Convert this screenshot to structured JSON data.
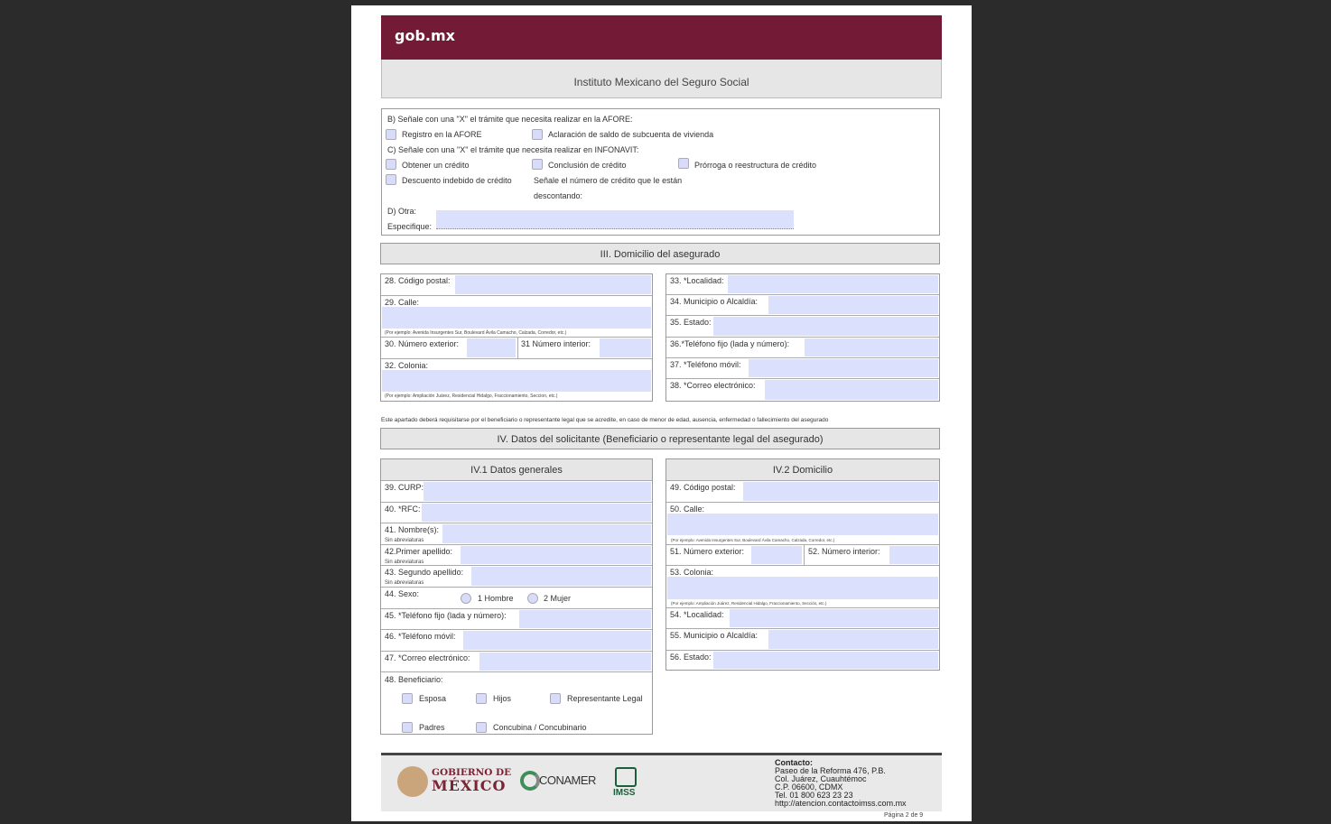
{
  "header": {
    "brand": "gob.mx",
    "institute": "Instituto Mexicano del Seguro Social"
  },
  "sectionBCD": {
    "b_prompt": "B) Señale con una \"X\" el trámite que necesita realizar en la AFORE:",
    "b_opt1": "Registro en la AFORE",
    "b_opt2": "Aclaración de saldo de subcuenta de vivienda",
    "c_prompt": "C) Señale con una \"X\" el trámite que necesita realizar en INFONAVIT:",
    "c_opt1": "Obtener un crédito",
    "c_opt2": "Conclusión de crédito",
    "c_opt3": "Prórroga o reestructura de crédito",
    "c_opt4": "Descuento indebido de crédito",
    "c_note1": "Señale el número de crédito que le están",
    "c_note2": "descontando:",
    "d_label": "D) Otra:",
    "d_spec": "Especifique:"
  },
  "sectionIII": {
    "title": "III. Domicilio del asegurado",
    "cp": "28. Código postal:",
    "calle": "29. Calle:",
    "calle_hint": "(Por ejemplo: Avenida Insurgentes Sur, Boulevard Ávila Camacho, Calzada, Corredor, etc.)",
    "num_ext": "30. Número exterior:",
    "num_int": "31 Número interior:",
    "colonia": "32. Colonia:",
    "colonia_hint": "(Por ejemplo: Ampliación Juárez, Residencial Hidalgo, Fraccionamiento, Seccion, etc.)",
    "localidad": "33. *Localidad:",
    "municipio": "34. Municipio o Alcaldía:",
    "estado": "35. Estado:",
    "tel_fijo": "36.*Teléfono fijo (lada y número):",
    "tel_movil": "37. *Teléfono móvil:",
    "correo": "38. *Correo electrónico:"
  },
  "notice": "Este apartado deberá requisitarse por el beneficiario o representante legal que se acredite, en caso de menor de edad, ausencia, enfermedad o fallecimiento del asegurado",
  "sectionIV": {
    "title": "IV. Datos del solicitante (Beneficiario o representante legal del asegurado)",
    "iv1_title": "IV.1 Datos generales",
    "curp": "39. CURP:",
    "rfc": "40. *RFC:",
    "nombre": "41. Nombre(s):",
    "sin_abrev": "Sin abreviaturas",
    "primer_ap": "42.Primer apellido:",
    "segundo_ap": "43. Segundo apellido:",
    "sexo": "44. Sexo:",
    "sexo_h": "1 Hombre",
    "sexo_m": "2 Mujer",
    "tel_fijo": "45. *Teléfono fijo (lada y número):",
    "tel_movil": "46. *Teléfono móvil:",
    "correo": "47. *Correo electrónico:",
    "benef": "48. Beneficiario:",
    "b_esposa": "Esposa",
    "b_hijos": "Hijos",
    "b_rep": "Representante Legal",
    "b_padres": "Padres",
    "b_concubina": "Concubina / Concubinario",
    "iv2_title": "IV.2 Domicilio",
    "cp": "49. Código postal:",
    "calle": "50. Calle:",
    "calle_hint": "(Por ejemplo: Avenida Insurgentes Sur, Boulevard Ávila Camacho, Calzada, Corredor, etc.)",
    "num_ext": "51. Número exterior:",
    "num_int": "52. Número interior:",
    "colonia": "53. Colonia:",
    "colonia_hint": "(Por ejemplo: Ampliación Juárez, Residencial Hidalgo, Fraccionamiento, Sección, etc.)",
    "localidad": "54. *Localidad:",
    "municipio": "55. Municipio o Alcaldía:",
    "estado": "56. Estado:"
  },
  "footer": {
    "gob_line1": "GOBIERNO DE",
    "gob_line2": "MÉXICO",
    "conamer": "CONAMER",
    "imss": "IMSS",
    "contact_title": "Contacto:",
    "c1": "Paseo de la Reforma 476, P.B.",
    "c2": "Col. Juárez, Cuauhtémoc",
    "c3": "C.P. 06600, CDMX",
    "c4": "Tel. 01 800 623 23 23",
    "c5": "http://atencion.contactoimss.com.mx",
    "page": "Página 2 de 9"
  },
  "colors": {
    "brand": "#721a36",
    "field": "#dbe0fd",
    "section": "#e6e6e6"
  }
}
